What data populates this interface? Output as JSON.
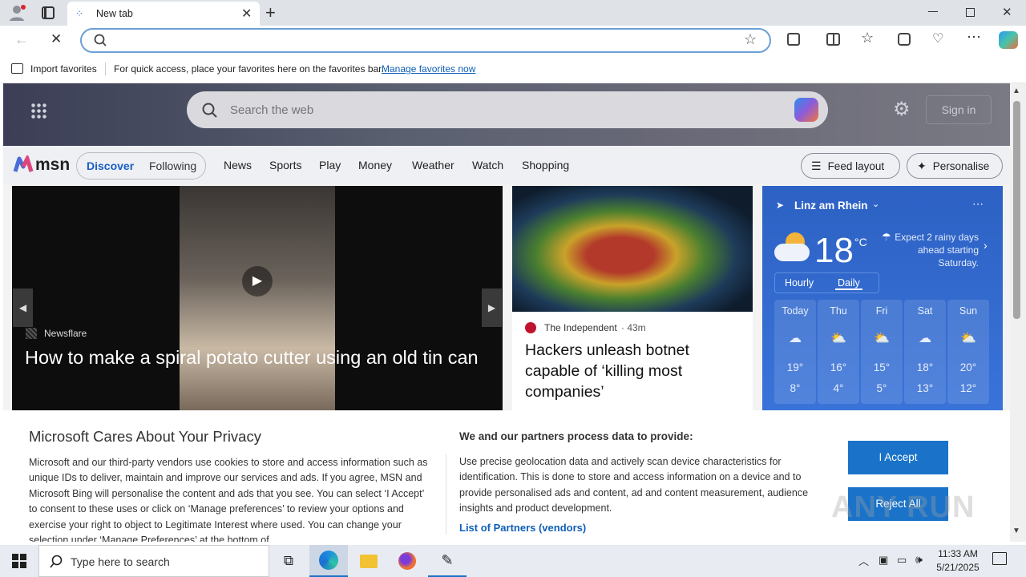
{
  "browser": {
    "tab_title": "New tab",
    "address_value": "",
    "favbar": {
      "import_label": "Import favorites",
      "hint": "For quick access, place your favorites here on the favorites bar.",
      "manage_link": "Manage favorites now"
    }
  },
  "msn": {
    "search_placeholder": "Search the web",
    "sign_in": "Sign in",
    "logo_text": "msn",
    "tabs": [
      "Discover",
      "Following"
    ],
    "nav": [
      "News",
      "Sports",
      "Play",
      "Money",
      "Weather",
      "Watch",
      "Shopping"
    ],
    "feed_layout": "Feed layout",
    "personalise": "Personalise"
  },
  "cards": {
    "main": {
      "source": "Newsflare",
      "title": "How to make a spiral potato cutter using an old tin can"
    },
    "second": {
      "source": "The Independent",
      "age": "· 43m",
      "title": "Hackers unleash botnet capable of ‘killing most companies’"
    }
  },
  "weather": {
    "location": "Linz am Rhein",
    "temp": "18",
    "unit": "°C",
    "note": "Expect 2 rainy days ahead starting Saturday.",
    "toggle": [
      "Hourly",
      "Daily"
    ],
    "days": [
      {
        "name": "Today",
        "hi": "19°",
        "lo": "8°"
      },
      {
        "name": "Thu",
        "hi": "16°",
        "lo": "4°"
      },
      {
        "name": "Fri",
        "hi": "15°",
        "lo": "5°"
      },
      {
        "name": "Sat",
        "hi": "18°",
        "lo": "13°"
      },
      {
        "name": "Sun",
        "hi": "20°",
        "lo": "12°"
      }
    ]
  },
  "consent": {
    "title": "Microsoft Cares About Your Privacy",
    "body": "Microsoft and our third-party vendors use cookies to store and access information such as unique IDs to deliver, maintain and improve our services and ads. If you agree, MSN and Microsoft Bing will personalise the content and ads that you see. You can select ‘I Accept’ to consent to these uses or click on ‘Manage preferences’ to review your options and exercise your right to object to Legitimate Interest where used. You can change your selection under ‘Manage Preferences’ at the bottom of",
    "partners_title": "We and our partners process data to provide:",
    "partners_body": "Use precise geolocation data and actively scan device characteristics for identification. This is done to store and access information on a device and to provide personalised ads and content, ad and content measurement, audience insights and product development.",
    "partners_link": "List of Partners (vendors)",
    "accept": "I Accept",
    "reject": "Reject All"
  },
  "watermark": "ANY RUN",
  "taskbar": {
    "search_placeholder": "Type here to search",
    "time": "11:33 AM",
    "date": "5/21/2025"
  },
  "colors": {
    "accent": "#1a73c9",
    "link": "#0f5fb8"
  }
}
